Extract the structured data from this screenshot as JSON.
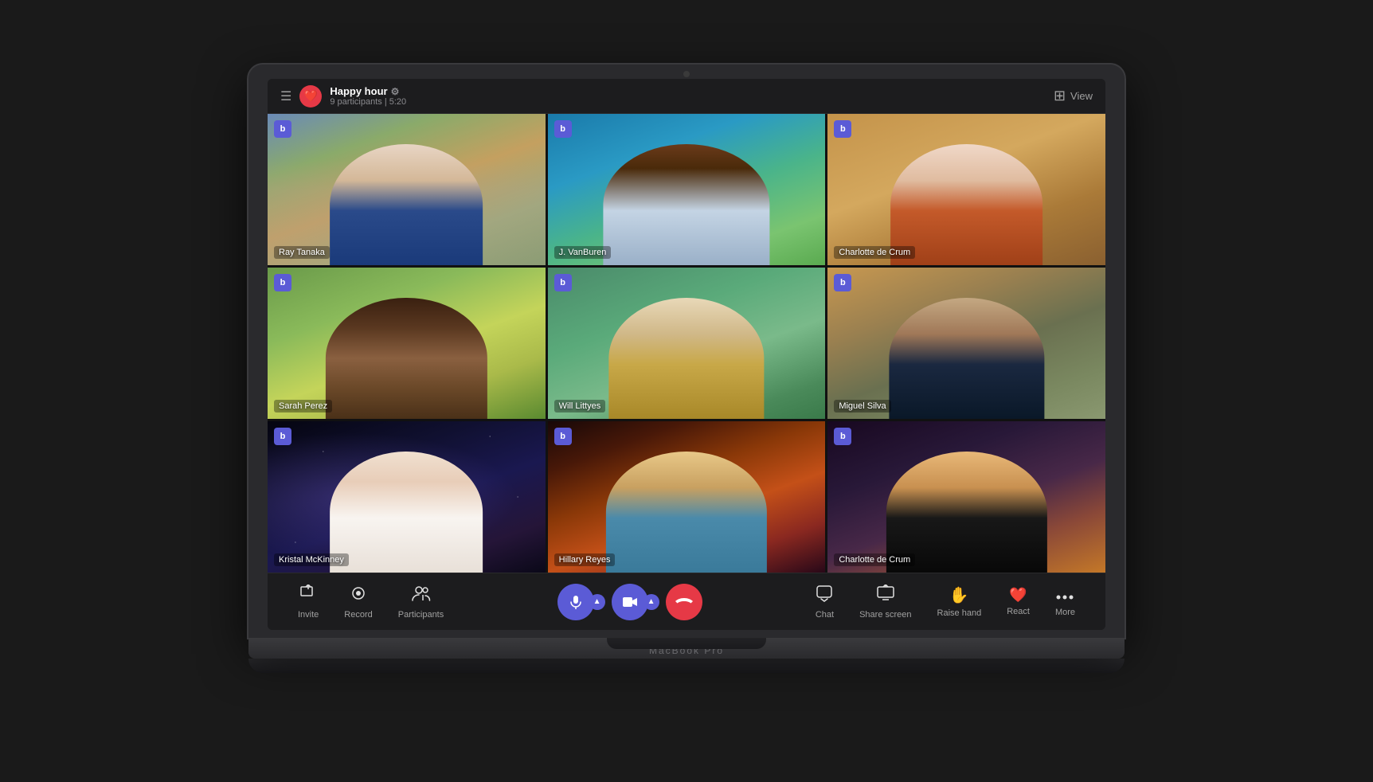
{
  "meeting": {
    "title": "Happy hour",
    "subtitle": "9 participants | 5:20",
    "icon": "❤️"
  },
  "header": {
    "view_label": "View",
    "hamburger": "☰",
    "gear": "⚙"
  },
  "participants": [
    {
      "id": "ray-tanaka",
      "name": "Ray Tanaka",
      "bg": "bg-mountains",
      "person": "person-ray"
    },
    {
      "id": "j-vanburen",
      "name": "J. VanBuren",
      "bg": "bg-beach",
      "person": "person-jvb"
    },
    {
      "id": "charlotte-de-crum-1",
      "name": "Charlotte de Crum",
      "bg": "bg-desert",
      "person": "person-charlotte1"
    },
    {
      "id": "sarah-perez",
      "name": "Sarah Perez",
      "bg": "bg-birds",
      "person": "person-sarah"
    },
    {
      "id": "will-littyes",
      "name": "Will Littyes",
      "bg": "bg-bridge",
      "person": "person-will"
    },
    {
      "id": "miguel-silva",
      "name": "Miguel Silva",
      "bg": "bg-wetlands",
      "person": "person-miguel"
    },
    {
      "id": "kristal-mckinney",
      "name": "Kristal McKinney",
      "bg": "bg-galaxy",
      "person": "person-kristal"
    },
    {
      "id": "hillary-reyes",
      "name": "Hillary Reyes",
      "bg": "bg-sunset",
      "person": "person-hillary"
    },
    {
      "id": "charlotte-de-crum-2",
      "name": "Charlotte de Crum",
      "bg": "bg-pyramid",
      "person": "person-charlotte2"
    }
  ],
  "toolbar": {
    "left_buttons": [
      {
        "id": "invite",
        "label": "Invite",
        "icon": "↑□"
      },
      {
        "id": "record",
        "label": "Record",
        "icon": "⏺"
      },
      {
        "id": "participants",
        "label": "Participants",
        "icon": "👥"
      }
    ],
    "right_buttons": [
      {
        "id": "chat",
        "label": "Chat",
        "icon": "💬"
      },
      {
        "id": "share-screen",
        "label": "Share screen",
        "icon": "⬆"
      },
      {
        "id": "raise-hand",
        "label": "Raise hand",
        "icon": "✋"
      },
      {
        "id": "react",
        "label": "React",
        "icon": "❤️"
      },
      {
        "id": "more",
        "label": "More",
        "icon": "⋯"
      }
    ]
  },
  "badge_label": "b",
  "laptop_brand": "MacBook Pro"
}
